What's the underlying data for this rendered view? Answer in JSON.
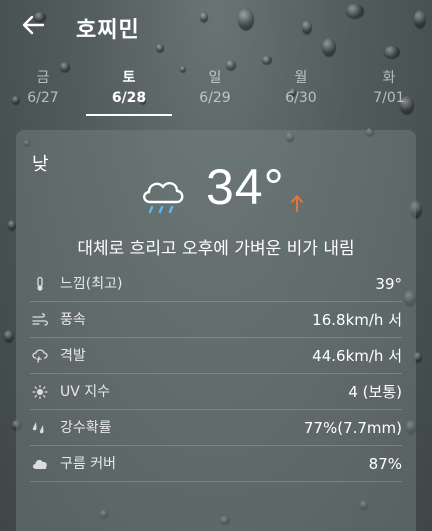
{
  "header": {
    "title": "호찌민"
  },
  "tabs": [
    {
      "day": "금",
      "date": "6/27"
    },
    {
      "day": "토",
      "date": "6/28"
    },
    {
      "day": "일",
      "date": "6/29"
    },
    {
      "day": "월",
      "date": "6/30"
    },
    {
      "day": "화",
      "date": "7/01"
    }
  ],
  "active_tab": 1,
  "card": {
    "period": "낮",
    "temperature": "34°",
    "description": "대체로 흐리고 오후에 가벼운 비가 내림",
    "trend_icon": "arrow-up-icon",
    "trend_color": "#e8743b",
    "weather_icon": "cloud-rain-icon",
    "details": [
      {
        "icon": "thermometer-icon",
        "label": "느낌(최고)",
        "value": "39°"
      },
      {
        "icon": "wind-icon",
        "label": "풍속",
        "value": "16.8km/h 서"
      },
      {
        "icon": "gust-icon",
        "label": "격발",
        "value": "44.6km/h 서"
      },
      {
        "icon": "sun-icon",
        "label": "UV 지수",
        "value": "4 (보통)"
      },
      {
        "icon": "rain-drops-icon",
        "label": "강수확률",
        "value": "77%(7.7mm)"
      },
      {
        "icon": "cloud-icon",
        "label": "구름 커버",
        "value": "87%"
      }
    ]
  }
}
